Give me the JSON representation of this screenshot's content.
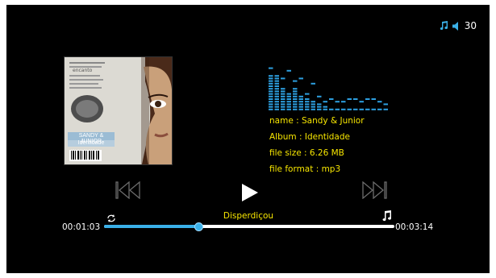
{
  "status_bar": {
    "volume_value": "30",
    "icons": [
      "music-note-icon",
      "speaker-icon"
    ]
  },
  "track_info": {
    "name": "name : Sandy & Junior",
    "album": "Album : Identidade",
    "file_size": "file size : 6.26 MB",
    "file_format": "file format :  mp3"
  },
  "player": {
    "title": "Disperdiçou",
    "elapsed": "00:01:03",
    "total": "00:03:14",
    "progress_fraction": 0.325
  },
  "album_art": {
    "artist_text": "SANDY & JUNIOR",
    "album_text": "Identidade",
    "header_text": "encanto"
  },
  "colors": {
    "info_text": "#f7e600",
    "accent": "#3ab0e8"
  }
}
